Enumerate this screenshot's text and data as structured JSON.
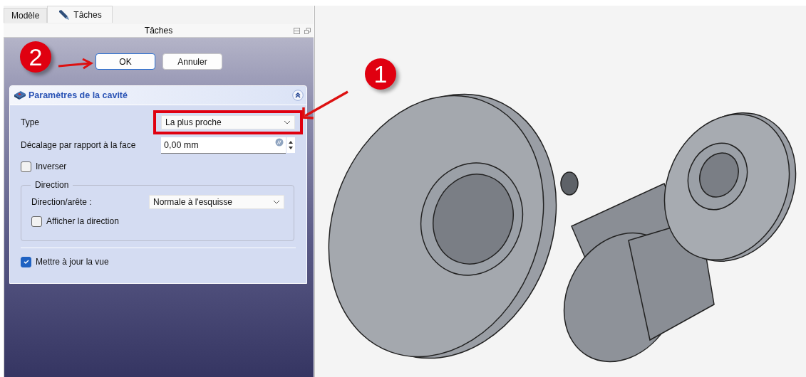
{
  "tabs": [
    {
      "label": "Modèle",
      "selected": false,
      "icon": false
    },
    {
      "label": "Tâches",
      "selected": true,
      "icon": true
    }
  ],
  "panel": {
    "title": "Tâches"
  },
  "buttons": [
    {
      "label": "OK",
      "focused": true
    },
    {
      "label": "Annuler",
      "focused": false
    }
  ],
  "callouts": [
    {
      "label": "2",
      "kind": "ok"
    },
    {
      "label": "1",
      "kind": "field"
    }
  ],
  "card": {
    "title": "Paramètres de la cavité",
    "rows": [
      {
        "kind": "combo",
        "label": "Type",
        "value": "La plus proche",
        "highlighted": true
      },
      {
        "kind": "spin",
        "label": "Décalage par rapport à la face",
        "value": "0,00 mm"
      },
      {
        "kind": "checkbox",
        "label": "Inverser",
        "checked": false
      },
      {
        "kind": "group",
        "title": "Direction",
        "rows": [
          {
            "kind": "combo",
            "label": "Direction/arête :",
            "value": "Normale à l'esquisse",
            "highlighted": false
          },
          {
            "kind": "checkbox",
            "label": "Afficher la direction",
            "checked": false
          }
        ]
      },
      {
        "kind": "separator"
      },
      {
        "kind": "checkbox",
        "label": "Mettre à jour la vue",
        "checked": true
      }
    ]
  }
}
